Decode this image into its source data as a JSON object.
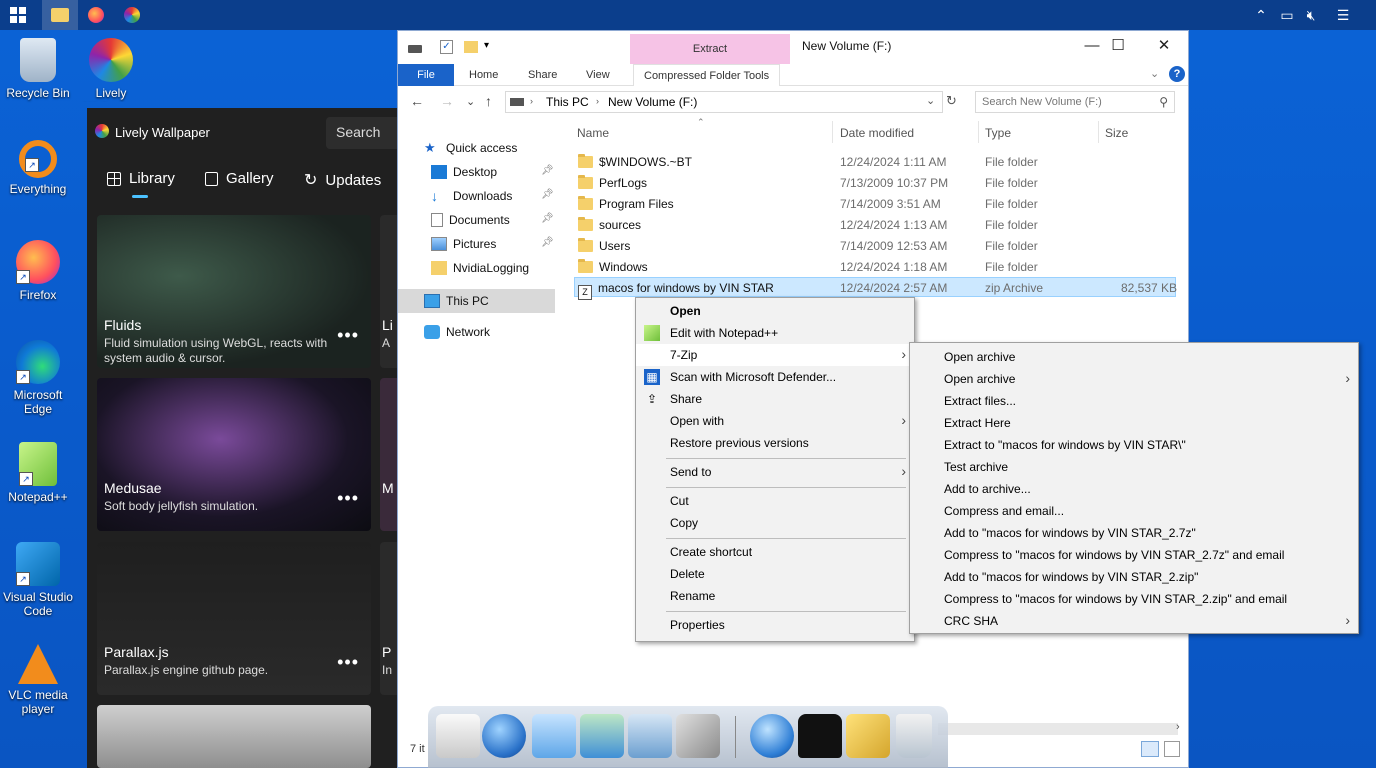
{
  "desktop_icons": [
    {
      "label": "Recycle Bin",
      "icon": "recycle-bin-icon"
    },
    {
      "label": "Lively Wallpaper",
      "icon": "lively-icon"
    },
    {
      "label": "Everything",
      "icon": "everything-icon"
    },
    {
      "label": "Firefox",
      "icon": "firefox-icon"
    },
    {
      "label": "Microsoft Edge",
      "icon": "edge-icon"
    },
    {
      "label": "Notepad++",
      "icon": "notepadpp-icon"
    },
    {
      "label": "Visual Studio Code",
      "icon": "vscode-icon"
    },
    {
      "label": "VLC media player",
      "icon": "vlc-icon"
    }
  ],
  "lively": {
    "title": "Lively Wallpaper",
    "search": "Search",
    "nav": {
      "library": "Library",
      "gallery": "Gallery",
      "updates": "Updates"
    },
    "cards": [
      {
        "title": "Fluids",
        "desc": "Fluid simulation using WebGL, reacts with system audio & cursor."
      },
      {
        "title": "Medusae",
        "desc": "Soft body jellyfish simulation."
      },
      {
        "title": "Parallax.js",
        "desc": "Parallax.js engine github page."
      }
    ],
    "peek": [
      "Li",
      "M",
      "P"
    ],
    "peek_desc": [
      "A",
      "",
      "In"
    ],
    "dots": "•••"
  },
  "explorer": {
    "title": "New Volume (F:)",
    "extract_header": "Extract",
    "tabs": {
      "file": "File",
      "home": "Home",
      "share": "Share",
      "view": "View",
      "tools": "Compressed Folder Tools"
    },
    "address": {
      "this_pc": "This PC",
      "volume": "New Volume (F:)"
    },
    "search_placeholder": "Search New Volume (F:)",
    "nav_pane": {
      "quick_access": "Quick access",
      "desktop": "Desktop",
      "downloads": "Downloads",
      "documents": "Documents",
      "pictures": "Pictures",
      "nvidia": "NvidiaLogging",
      "this_pc": "This PC",
      "network": "Network"
    },
    "columns": {
      "name": "Name",
      "date": "Date modified",
      "type": "Type",
      "size": "Size"
    },
    "rows": [
      {
        "name": "$WINDOWS.~BT",
        "date": "12/24/2024 1:11 AM",
        "type": "File folder",
        "size": ""
      },
      {
        "name": "PerfLogs",
        "date": "7/13/2009 10:37 PM",
        "type": "File folder",
        "size": ""
      },
      {
        "name": "Program Files",
        "date": "7/14/2009 3:51 AM",
        "type": "File folder",
        "size": ""
      },
      {
        "name": "sources",
        "date": "12/24/2024 1:13 AM",
        "type": "File folder",
        "size": ""
      },
      {
        "name": "Users",
        "date": "7/14/2009 12:53 AM",
        "type": "File folder",
        "size": ""
      },
      {
        "name": "Windows",
        "date": "12/24/2024 1:18 AM",
        "type": "File folder",
        "size": ""
      },
      {
        "name": "macos for windows by VIN STAR",
        "date": "12/24/2024 2:57 AM",
        "type": "zip Archive",
        "size": "82,537 KB"
      }
    ],
    "status": "7 it"
  },
  "context_menu": {
    "open": "Open",
    "edit_npp": "Edit with Notepad++",
    "sevenzip": "7-Zip",
    "defender": "Scan with Microsoft Defender...",
    "share": "Share",
    "open_with": "Open with",
    "restore": "Restore previous versions",
    "send_to": "Send to",
    "cut": "Cut",
    "copy": "Copy",
    "create_shortcut": "Create shortcut",
    "delete": "Delete",
    "rename": "Rename",
    "properties": "Properties"
  },
  "sevenzip_menu": [
    {
      "label": "Open archive",
      "arrow": false
    },
    {
      "label": "Open archive",
      "arrow": true
    },
    {
      "label": "Extract files...",
      "arrow": false
    },
    {
      "label": "Extract Here",
      "arrow": false
    },
    {
      "label": "Extract to \"macos for windows by VIN STAR\\\"",
      "arrow": false
    },
    {
      "label": "Test archive",
      "arrow": false
    },
    {
      "label": "Add to archive...",
      "arrow": false
    },
    {
      "label": "Compress and email...",
      "arrow": false
    },
    {
      "label": "Add to \"macos for windows by VIN STAR_2.7z\"",
      "arrow": false
    },
    {
      "label": "Compress to \"macos for windows by VIN STAR_2.7z\" and email",
      "arrow": false
    },
    {
      "label": "Add to \"macos for windows by VIN STAR_2.zip\"",
      "arrow": false
    },
    {
      "label": "Compress to \"macos for windows by VIN STAR_2.zip\" and email",
      "arrow": false
    },
    {
      "label": "CRC SHA",
      "arrow": true
    }
  ],
  "colors": {
    "accent": "#1a63c9",
    "selection": "#cce8ff",
    "extract_tab": "#f6c3e6"
  }
}
